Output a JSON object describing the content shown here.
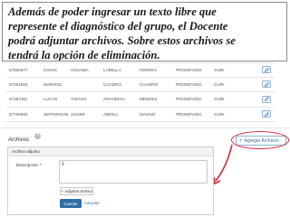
{
  "caption": {
    "line1": "Además de poder ingresar un texto libre que",
    "line2": "represente el diagnóstico del grupo, el Docente",
    "line3": "podrá adjuntar archivos. Sobre estos archivos se",
    "line4": "tendrá la opción de eliminación."
  },
  "students": [
    {
      "id": "57550977",
      "first": "IOHAN",
      "middle": "OSSAMA",
      "last1": "LABELLA",
      "last2": "PERERA",
      "status": "PROMOVIDO",
      "group": "GURI"
    },
    {
      "id": "57281863",
      "first": "MARISOL",
      "middle": "",
      "last1": "CUADRO",
      "last2": "CUADRO",
      "status": "PROMOVIDO",
      "group": "GURI"
    },
    {
      "id": "57367481",
      "first": "LUCAS",
      "middle": "THIAGO",
      "last1": "ARANDIGA",
      "last2": "MENDEZ",
      "status": "PROMOVIDO",
      "group": "GURI"
    },
    {
      "id": "57766983",
      "first": "JEFFERSON",
      "middle": "JAVIER",
      "last1": "ABREU",
      "last2": "MAGNO",
      "status": "PROMOVIDO",
      "group": "GURI"
    }
  ],
  "archivos": {
    "title": "Archivos",
    "help_icon": "?",
    "add_files_label": "Agregar Archivos",
    "add_icon": "+"
  },
  "panel": {
    "header": "Archivo adjunto",
    "description_label": "Descripción: *",
    "description_value": "1",
    "attach_label": "Adjuntar archivo",
    "save_label": "Guardar",
    "cancel_label": "Cancelar"
  },
  "colors": {
    "annotation_red": "#d6243a",
    "primary_blue": "#2f6ea8",
    "button_border": "#8fb2d6"
  }
}
